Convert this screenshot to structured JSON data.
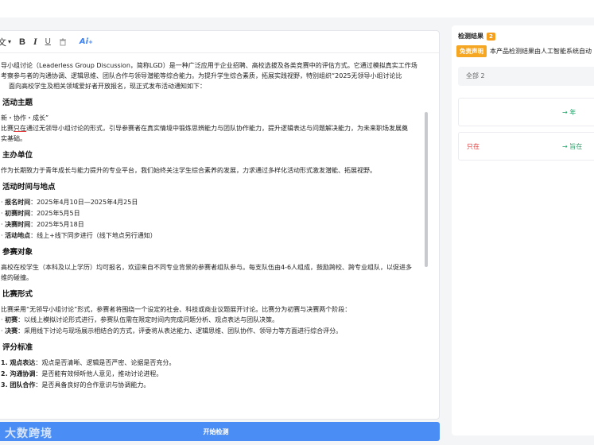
{
  "toolbar": {
    "font_label": "文",
    "bold": "B",
    "italic": "I",
    "underline": "U",
    "clear": "🗑",
    "ai": "Ai"
  },
  "doc": {
    "intro1": "导小组讨论（Leaderless Group Discussion，简称LGD）是一种广泛应用于企业招聘、高校选拔及各类竞赛中的评估方式。它通过模拟真实工作场",
    "intro2": "考察参与者的沟通协调、逻辑思维、团队合作与领导潜能等综合能力。为提升学生综合素质，拓展实践视野，特别组织“2025无领导小组讨论比",
    "intro3": "面向高校学生及相关领域爱好者开放报名，现正式发布活动通知如下：",
    "h_theme": "活动主题",
    "theme": "新・协作・成长”",
    "theme_desc_pre": "比赛",
    "theme_desc_mark": "只在",
    "theme_desc_post": "通过无领导小组讨论的形式，引导参赛者在真实情境中锻炼思辨能力与团队协作能力，提升逻辑表达与问题解决能力，为未来职场发展奠",
    "theme_desc2": "实基础。",
    "h_org": "主办单位",
    "org": "作为长期致力于青年成长与能力提升的专业平台，我们始终关注学生综合素养的发展，力求通过多样化活动形式激发潜能、拓展视野。",
    "h_time": "活动时间与地点",
    "time_items": [
      {
        "label": "报名时间",
        "value": "：2025年4月10日—2025年4月25日"
      },
      {
        "label": "初赛时间",
        "value": "：2025年5月5日"
      },
      {
        "label": "决赛时间",
        "value": "：2025年5月18日"
      },
      {
        "label": "活动地点",
        "value": "：线上+线下同步进行（线下地点另行通知）"
      }
    ],
    "h_target": "参赛对象",
    "target1": "高校在校学生（本科及以上学历）均可报名，欢迎来自不同专业背景的参赛者组队参与。每支队伍由4-6人组成，鼓励跨校、跨专业组队，以促进多",
    "target2": "维的碰撞。",
    "h_format": "比赛形式",
    "format": "比赛采用“无领导小组讨论”形式，参赛者将围绕一个设定的社会、科技或商业议题展开讨论。比赛分为初赛与决赛两个阶段：",
    "format_items": [
      {
        "label": "初赛",
        "value": "：以线上模拟讨论形式进行，参赛队伍需在限定时间内完成问题分析、观点表达与团队决策。"
      },
      {
        "label": "决赛",
        "value": "：采用线下讨论与现场展示相结合的方式，评委将从表达能力、逻辑思维、团队协作、领导力等方面进行综合评分。"
      }
    ],
    "h_criteria": "评分标准",
    "criteria_items": [
      {
        "label": "1. 观点表达",
        "value": "：观点是否清晰、逻辑是否严密、论据是否充分。"
      },
      {
        "label": "2. 沟通协调",
        "value": "：是否能有效倾听他人意见，推动讨论进程。"
      },
      {
        "label": "3. 团队合作",
        "value": "：是否具备良好的合作意识与协调能力。"
      }
    ]
  },
  "start_button": "开始检测",
  "watermark": "大数跨境",
  "panel": {
    "title": "检测结果",
    "count": "2",
    "disclaimer_badge": "免责声明",
    "disclaimer_text": "本产品检测结果由人工智能系统自动",
    "filter_all": "全部 2",
    "results": [
      {
        "original": "",
        "arrow": "→ 年"
      },
      {
        "original": "只在",
        "arrow": "→ 旨在"
      }
    ]
  }
}
